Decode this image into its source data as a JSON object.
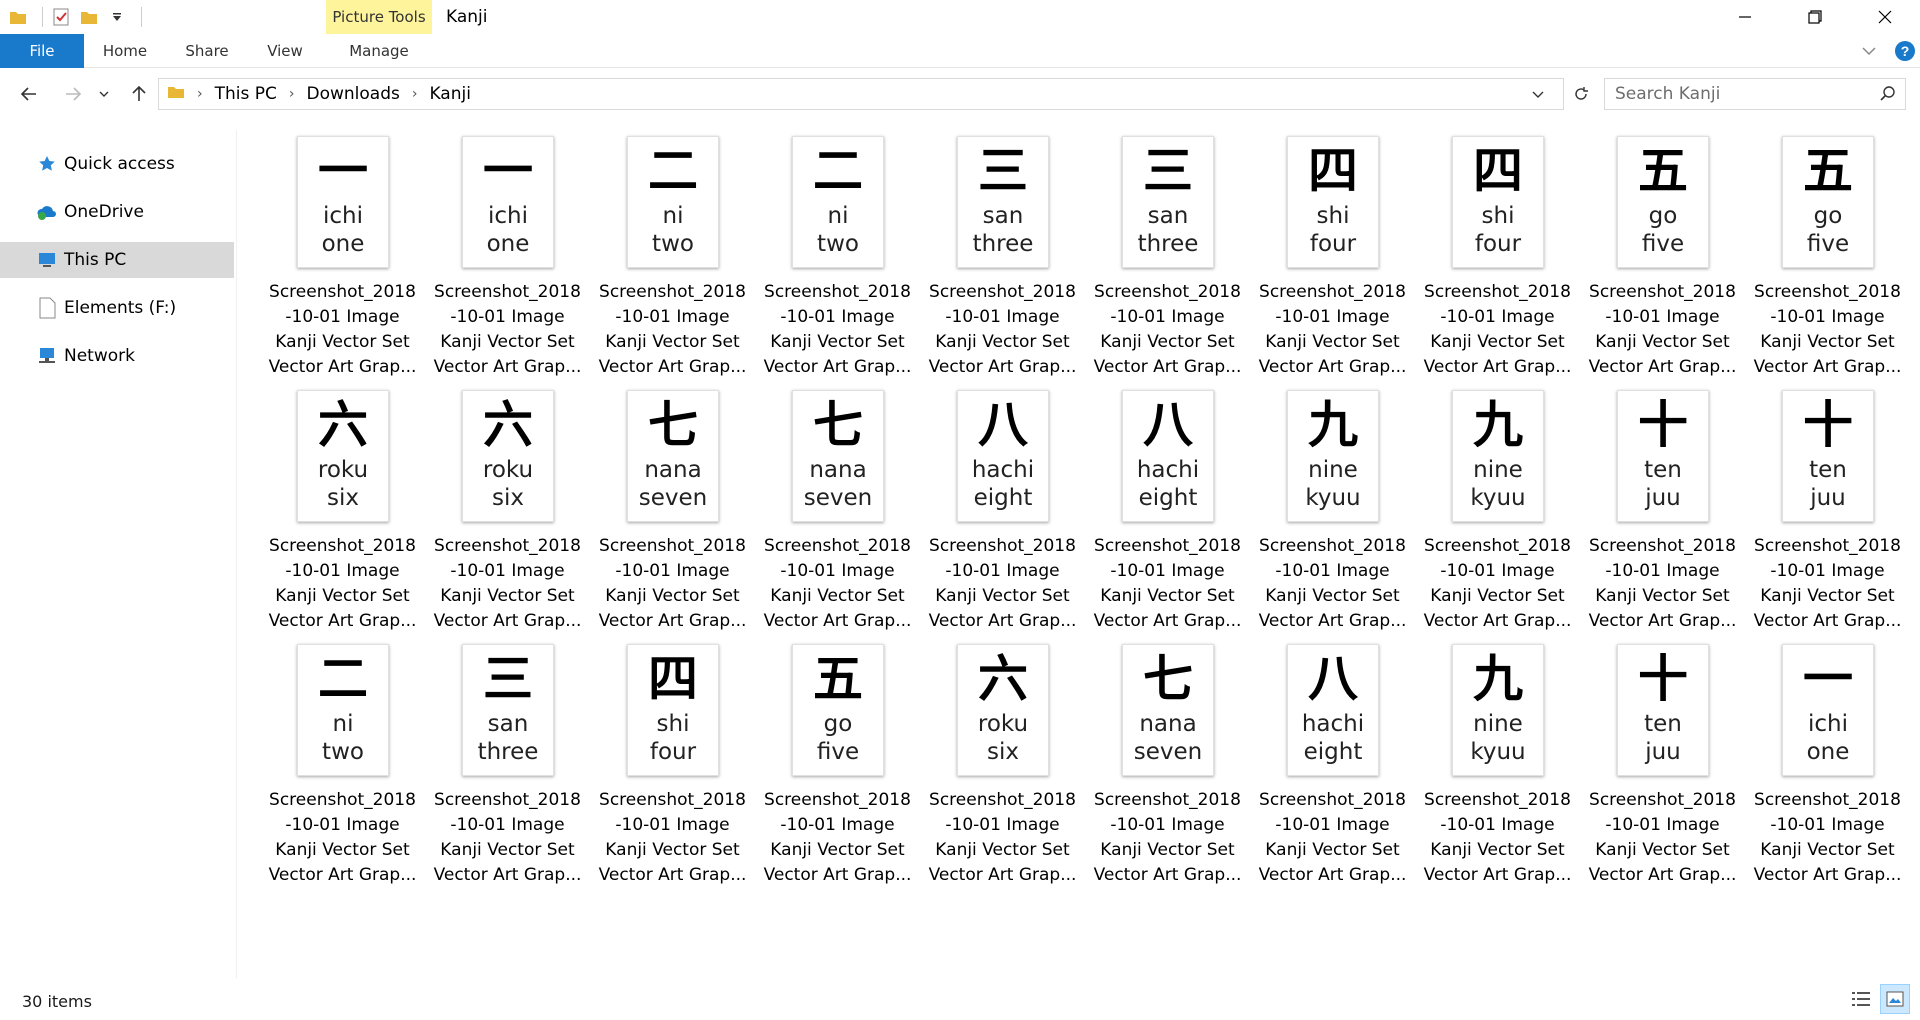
{
  "window": {
    "title": "Kanji",
    "context_tab_group": "Picture Tools"
  },
  "ribbon": {
    "tabs": [
      "File",
      "Home",
      "Share",
      "View",
      "Manage"
    ]
  },
  "address": {
    "crumbs": [
      "This PC",
      "Downloads",
      "Kanji"
    ]
  },
  "search": {
    "placeholder": "Search Kanji"
  },
  "navpane": {
    "items": [
      {
        "label": "Quick access",
        "icon": "star-icon"
      },
      {
        "label": "OneDrive",
        "icon": "cloud-icon"
      },
      {
        "label": "This PC",
        "icon": "computer-icon",
        "selected": true
      },
      {
        "label": "Elements (F:)",
        "icon": "drive-icon"
      },
      {
        "label": "Network",
        "icon": "network-icon"
      }
    ]
  },
  "file_label": {
    "line1": "Screenshot_2018",
    "line2": "-10-01 Image",
    "line3": "Kanji Vector Set",
    "line4": "Vector Art Grap..."
  },
  "files": [
    {
      "kanji": "一",
      "r": "ichi",
      "e": "one"
    },
    {
      "kanji": "一",
      "r": "ichi",
      "e": "one"
    },
    {
      "kanji": "二",
      "r": "ni",
      "e": "two"
    },
    {
      "kanji": "二",
      "r": "ni",
      "e": "two"
    },
    {
      "kanji": "三",
      "r": "san",
      "e": "three"
    },
    {
      "kanji": "三",
      "r": "san",
      "e": "three"
    },
    {
      "kanji": "四",
      "r": "shi",
      "e": "four"
    },
    {
      "kanji": "四",
      "r": "shi",
      "e": "four"
    },
    {
      "kanji": "五",
      "r": "go",
      "e": "five"
    },
    {
      "kanji": "五",
      "r": "go",
      "e": "five"
    },
    {
      "kanji": "六",
      "r": "roku",
      "e": "six"
    },
    {
      "kanji": "六",
      "r": "roku",
      "e": "six"
    },
    {
      "kanji": "七",
      "r": "nana",
      "e": "seven"
    },
    {
      "kanji": "七",
      "r": "nana",
      "e": "seven"
    },
    {
      "kanji": "八",
      "r": "hachi",
      "e": "eight"
    },
    {
      "kanji": "八",
      "r": "hachi",
      "e": "eight"
    },
    {
      "kanji": "九",
      "r": "nine",
      "e": "kyuu"
    },
    {
      "kanji": "九",
      "r": "nine",
      "e": "kyuu"
    },
    {
      "kanji": "十",
      "r": "ten",
      "e": "juu"
    },
    {
      "kanji": "十",
      "r": "ten",
      "e": "juu"
    },
    {
      "kanji": "二",
      "r": "ni",
      "e": "two"
    },
    {
      "kanji": "三",
      "r": "san",
      "e": "three"
    },
    {
      "kanji": "四",
      "r": "shi",
      "e": "four"
    },
    {
      "kanji": "五",
      "r": "go",
      "e": "five"
    },
    {
      "kanji": "六",
      "r": "roku",
      "e": "six"
    },
    {
      "kanji": "七",
      "r": "nana",
      "e": "seven"
    },
    {
      "kanji": "八",
      "r": "hachi",
      "e": "eight"
    },
    {
      "kanji": "九",
      "r": "nine",
      "e": "kyuu"
    },
    {
      "kanji": "十",
      "r": "ten",
      "e": "juu"
    },
    {
      "kanji": "一",
      "r": "ichi",
      "e": "one"
    }
  ],
  "status": {
    "item_count": "30 items"
  }
}
